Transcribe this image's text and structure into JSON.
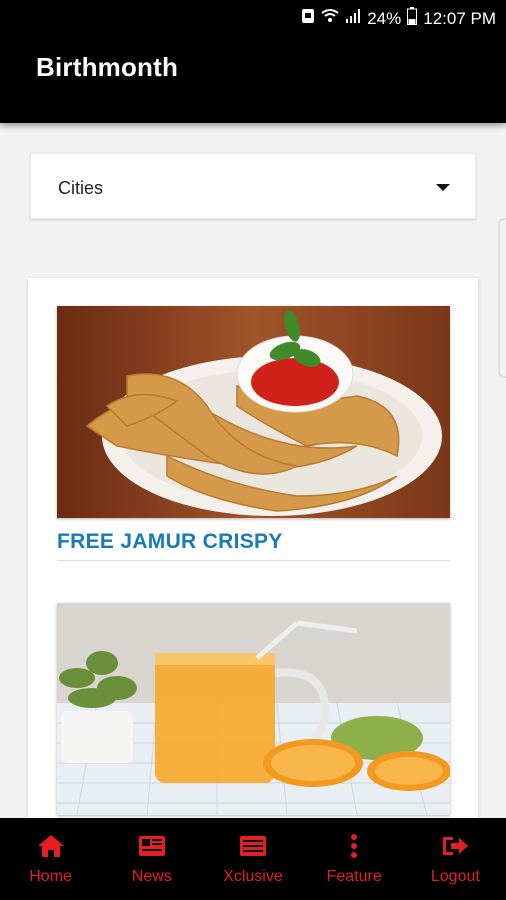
{
  "status_bar": {
    "battery": "24%",
    "time": "12:07 PM"
  },
  "app": {
    "title": "Birthmonth"
  },
  "filter": {
    "selected": "Cities"
  },
  "posts": [
    {
      "title": "FREE JAMUR CRISPY"
    },
    {
      "title": ""
    }
  ],
  "bottom_nav": {
    "color": "#e31e24",
    "items": [
      {
        "label": "Home",
        "icon": "home-icon"
      },
      {
        "label": "News",
        "icon": "news-icon"
      },
      {
        "label": "Xclusive",
        "icon": "xclusive-icon"
      },
      {
        "label": "Feature",
        "icon": "more-vertical-icon"
      },
      {
        "label": "Logout",
        "icon": "logout-icon"
      }
    ]
  }
}
